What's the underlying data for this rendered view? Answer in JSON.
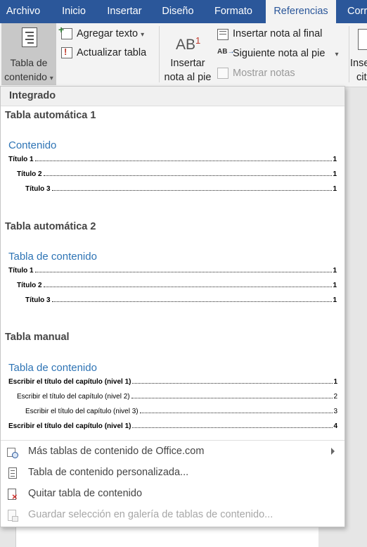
{
  "ribbon_tabs": [
    "Archivo",
    "Inicio",
    "Insertar",
    "Diseño",
    "Formato",
    "Referencias",
    "Corr"
  ],
  "active_tab": "Referencias",
  "colors": {
    "accent": "#2b579a",
    "toc_heading": "#2e74b5"
  },
  "ribbon": {
    "toc_button": {
      "line1": "Tabla de",
      "line2": "contenido",
      "icon": "toc-document-icon"
    },
    "add_text": "Agregar texto",
    "update_table": "Actualizar tabla",
    "insert_footnote": {
      "line1": "Insertar",
      "line2": "nota al pie",
      "glyph": "AB",
      "sup": "1"
    },
    "insert_endnote": "Insertar nota al final",
    "next_footnote": "Siguiente nota al pie",
    "show_notes": "Mostrar notas",
    "insert_citation": {
      "line1": "Inse",
      "line2": "cit"
    }
  },
  "gallery": {
    "group_header": "Integrado",
    "auto1": {
      "title": "Tabla automática 1",
      "heading": "Contenido",
      "entries": [
        {
          "text": "Título 1",
          "page": "1"
        },
        {
          "text": "Título 2",
          "page": "1"
        },
        {
          "text": "Título 3",
          "page": "1"
        }
      ]
    },
    "auto2": {
      "title": "Tabla automática 2",
      "heading": "Tabla de contenido",
      "entries": [
        {
          "text": "Título 1",
          "page": "1"
        },
        {
          "text": "Título 2",
          "page": "1"
        },
        {
          "text": "Título 3",
          "page": "1"
        }
      ]
    },
    "manual": {
      "title": "Tabla manual",
      "heading": "Tabla de contenido",
      "entries": [
        {
          "text": "Escribir el título del capítulo (nivel 1)",
          "page": "1"
        },
        {
          "text": "Escribir el título del capítulo (nivel 2)",
          "page": "2"
        },
        {
          "text": "Escribir el título del capítulo (nivel 3)",
          "page": "3"
        },
        {
          "text": "Escribir el título del capítulo (nivel 1)",
          "page": "4"
        }
      ]
    }
  },
  "menu": {
    "more_tables": "Más tablas de contenido de Office.com",
    "custom_toc": "Tabla de contenido personalizada...",
    "remove_toc": "Quitar tabla de contenido",
    "save_selection": "Guardar selección en galería de tablas de contenido..."
  }
}
